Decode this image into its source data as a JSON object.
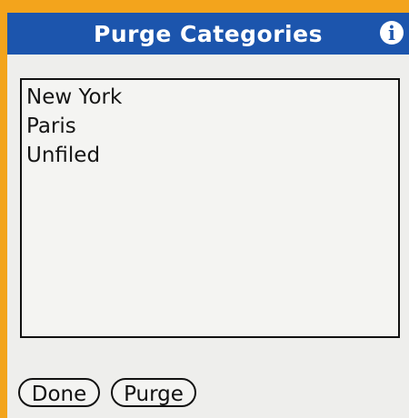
{
  "dialog": {
    "title": "Purge Categories",
    "info_icon_glyph": "i",
    "info_icon": "info-icon"
  },
  "categories": [
    "New York",
    "Paris",
    "Unfiled"
  ],
  "buttons": {
    "done_label": "Done",
    "purge_label": "Purge"
  },
  "colors": {
    "title_bar": "#1c55ad",
    "frame": "#f3a41c",
    "dialog_background": "#eeeeec"
  }
}
